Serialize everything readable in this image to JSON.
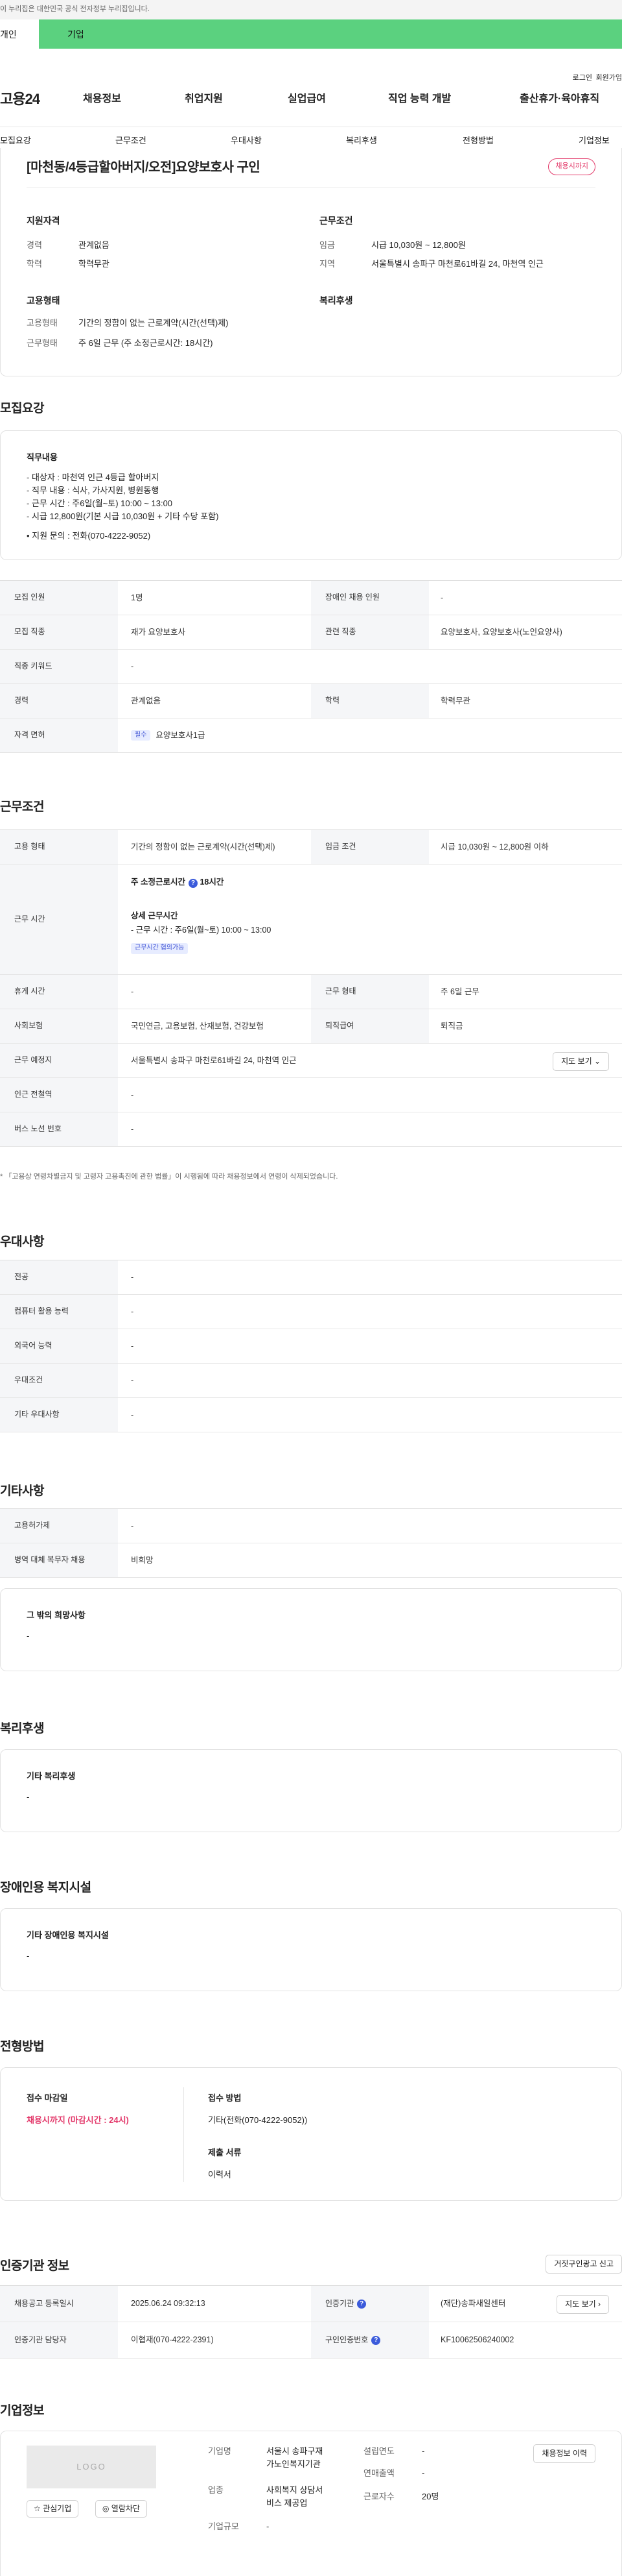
{
  "notice": "이 누리집은 대한민국 공식 전자정부 누리집입니다.",
  "tabs": {
    "personal": "개인",
    "company": "기업"
  },
  "util": {
    "login": "로그인",
    "join": "회원가입"
  },
  "logo": "고용24",
  "gnb": [
    "채용정보",
    "취업지원",
    "실업급여",
    "직업 능력 개발",
    "출산휴가·육아휴직"
  ],
  "subnav": [
    "모집요강",
    "근무조건",
    "우대사항",
    "복리후생",
    "전형방법",
    "기업정보"
  ],
  "summary": {
    "title": "[마천동/4등급할아버지/오전]요양보호사 구인",
    "badge": "채용시까지",
    "qual_head": "지원자격",
    "cond_head": "근무조건",
    "career_l": "경력",
    "career_v": "관계없음",
    "edu_l": "학력",
    "edu_v": "학력무관",
    "wage_l": "임금",
    "wage_v": "시급 10,030원 ~ 12,800원",
    "area_l": "지역",
    "area_v": "서울특별시 송파구 마천로61바길 24, 마천역 인근",
    "emp_head": "고용형태",
    "welfare_head": "복리후생",
    "emptype_l": "고용형태",
    "emptype_v": "기간의 정함이 없는 근로계약(시간(선택)제)",
    "worktype_l": "근무형태",
    "worktype_v": "주 6일 근무 (주 소정근로시간: 18시간)"
  },
  "recruit": {
    "heading": "모집요강",
    "duty_label": "직무내용",
    "duty_lines": [
      "- 대상자 : 마천역 인근 4등급 할아버지",
      "- 직무 내용 : 식사, 가사지원, 병원동행",
      "- 근무 시간 : 주6일(월~토) 10:00 ~ 13:00",
      "- 시급 12,800원(기본 시급 10,030원 + 기타 수당 포함)",
      "",
      "• 지원 문의 : 전화(070-4222-9052)"
    ],
    "rows": [
      {
        "th": "모집 인원",
        "td": "1명",
        "th2": "장애인 채용 인원",
        "td2": "-"
      },
      {
        "th": "모집 직종",
        "td": "재가 요양보호사",
        "th2": "관련 직종",
        "td2": "요양보호사, 요양보호사(노인요양사)"
      },
      {
        "th": "직종 키워드",
        "td": "-"
      },
      {
        "th": "경력",
        "td": "관계없음",
        "th2": "학력",
        "td2": "학력무관"
      },
      {
        "th": "자격 면허",
        "tag": "필수",
        "td": "요양보호사1급"
      }
    ]
  },
  "conditions": {
    "heading": "근무조건",
    "emp_th": "고용 형태",
    "emp_td": "기간의 정함이 없는 근로계약(시간(선택)제)",
    "wage_th": "임금 조건",
    "wage_td": "시급 10,030원 ~ 12,800원 이하",
    "time_th": "근무 시간",
    "time_weekly": "주 소정근로시간",
    "time_hours": "18시간",
    "time_detail_head": "상세 근무시간",
    "time_detail": "- 근무 시간 : 주6일(월~토) 10:00 ~ 13:00",
    "time_tag": "근무시간 협의가능",
    "rest_th": "휴게 시간",
    "rest_td": "-",
    "form_th": "근무 형태",
    "form_td": "주 6일 근무",
    "ins_th": "사회보험",
    "ins_td": "국민연금, 고용보험, 산재보험, 건강보험",
    "ret_th": "퇴직급여",
    "ret_td": "퇴직금",
    "place_th": "근무 예정지",
    "place_td": "서울특별시 송파구 마천로61바길 24, 마천역 인근",
    "map_btn": "지도 보기 ⌄",
    "subway_th": "인근 전철역",
    "subway_td": "-",
    "bus_th": "버스 노선 번호",
    "bus_td": "-",
    "note": "* 「고용상 연령차별금지 및 고령자 고용촉진에 관한 법률」이 시행됨에 따라 채용정보에서 연령이 삭제되었습니다."
  },
  "preference": {
    "heading": "우대사항",
    "rows": [
      {
        "th": "전공",
        "td": "-"
      },
      {
        "th": "컴퓨터 활용 능력",
        "td": "-"
      },
      {
        "th": "외국어 능력",
        "td": "-"
      },
      {
        "th": "우대조건",
        "td": "-"
      },
      {
        "th": "기타 우대사항",
        "td": "-"
      }
    ]
  },
  "etc": {
    "heading": "기타사항",
    "rows": [
      {
        "th": "고용허가제",
        "td": "-"
      },
      {
        "th": "병역 대체 복무자 채용",
        "td": "비희망"
      }
    ],
    "wish_head": "그 밖의 희망사항",
    "wish_v": "-"
  },
  "welfare": {
    "heading": "복리후생",
    "label": "기타 복리후생",
    "value": "-"
  },
  "disabled": {
    "heading": "장애인용 복지시설",
    "label": "기타 장애인용 복지시설",
    "value": "-"
  },
  "selection": {
    "heading": "전형방법",
    "deadline_l": "접수 마감일",
    "deadline_v": "채용시까지 (마감시간 : 24시)",
    "method_l": "접수 방법",
    "method_v": "기타(전화(070-4222-9052))",
    "docs_l": "제출 서류",
    "docs_v": "이력서"
  },
  "agency": {
    "heading": "인증기관 정보",
    "report_btn": "거짓구인광고 신고",
    "reg_th": "채용공고 등록일시",
    "reg_td": "2025.06.24 09:32:13",
    "agency_th": "인증기관",
    "agency_td": "(재단)송파새일센터",
    "map_btn": "지도 보기 ›",
    "mgr_th": "인증기관 담당자",
    "mgr_td": "이협재(070-4222-2391)",
    "no_th": "구인인증번호",
    "no_td": "KF10062506240002"
  },
  "company": {
    "heading": "기업정보",
    "logo": "LOGO",
    "fav_btn": "☆ 관심기업",
    "block_btn": "◎ 열람차단",
    "hist_btn": "채용정보 이력",
    "name_l": "기업명",
    "name_v1": "서울시 송파구재",
    "name_v2": "가노인복지기관",
    "year_l": "설립연도",
    "year_v": "-",
    "sales_l": "연매출액",
    "sales_v": "-",
    "ind_l": "업종",
    "ind_v1": "사회복지 상담서",
    "ind_v2": "비스 제공업",
    "emp_l": "근로자수",
    "emp_v": "20명",
    "size_l": "기업규모",
    "size_v": "-"
  }
}
